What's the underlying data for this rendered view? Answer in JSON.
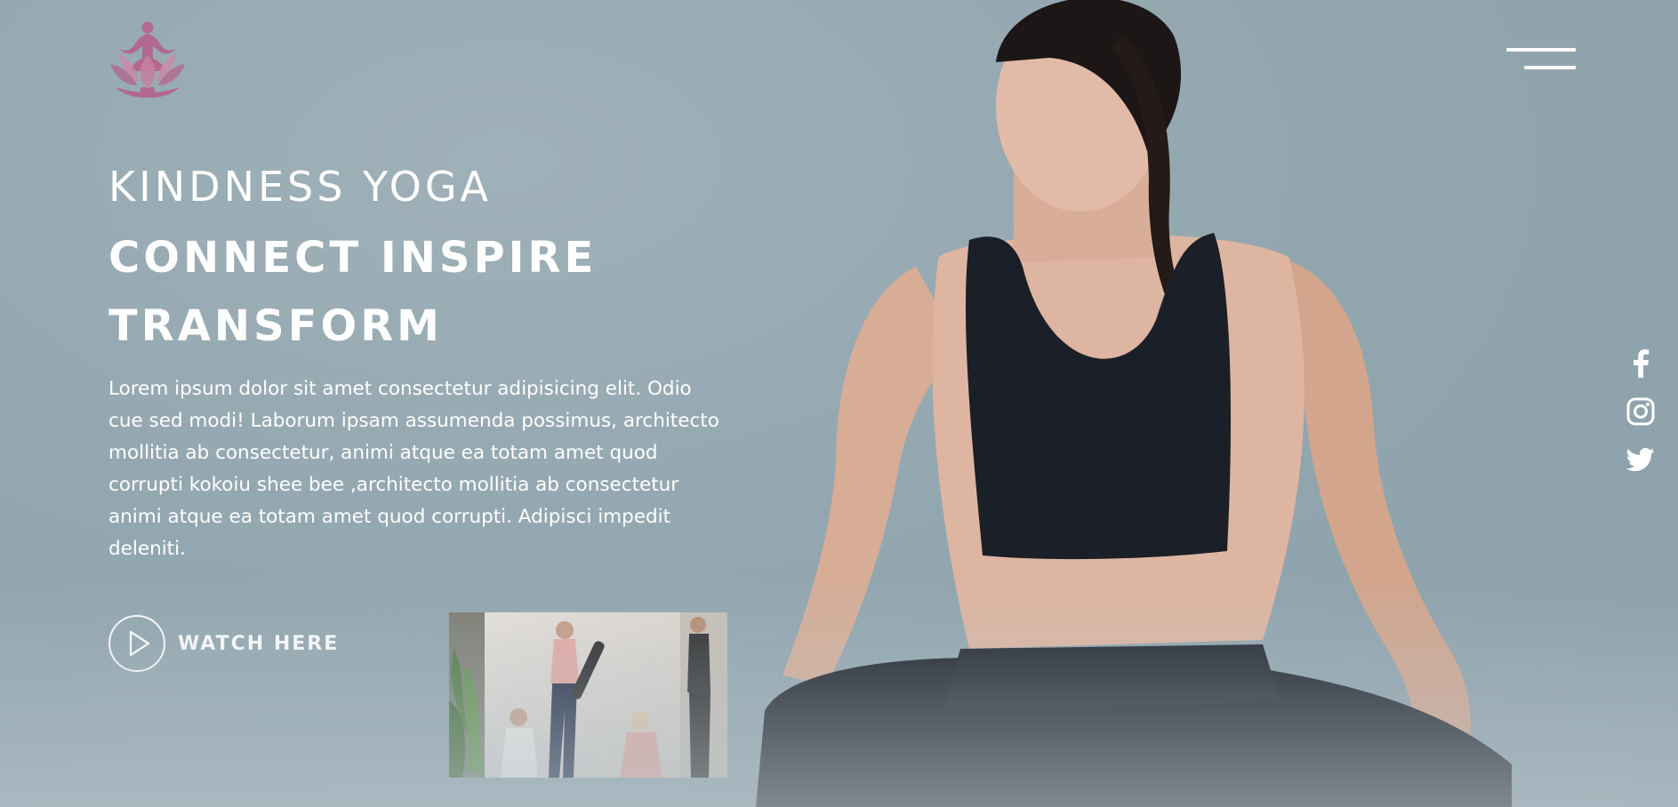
{
  "brand": {
    "name": "KINDNESS YOGA"
  },
  "hero": {
    "headline_line1": "CONNECT INSPIRE",
    "headline_line2": "TRANSFORM",
    "description": "Lorem ipsum dolor sit amet consectetur adipisicing elit. Odio cue sed modi! Laborum ipsam assumenda possimus, architecto mollitia ab consectetur, animi atque ea totam amet quod corrupti kokoiu shee bee ,architecto mollitia ab consectetur animi atque ea totam amet quod corrupti. Adipisci impedit deleniti.",
    "watch_label": "WATCH HERE"
  },
  "icons": {
    "logo": "lotus-meditation-logo",
    "menu": "hamburger-menu-icon",
    "play": "play-icon",
    "social": [
      "facebook-icon",
      "instagram-icon",
      "twitter-icon"
    ]
  },
  "colors": {
    "background": "#93a7b0",
    "text": "#ffffff",
    "logo": "#b2698f",
    "garment": "#1b1f27"
  }
}
